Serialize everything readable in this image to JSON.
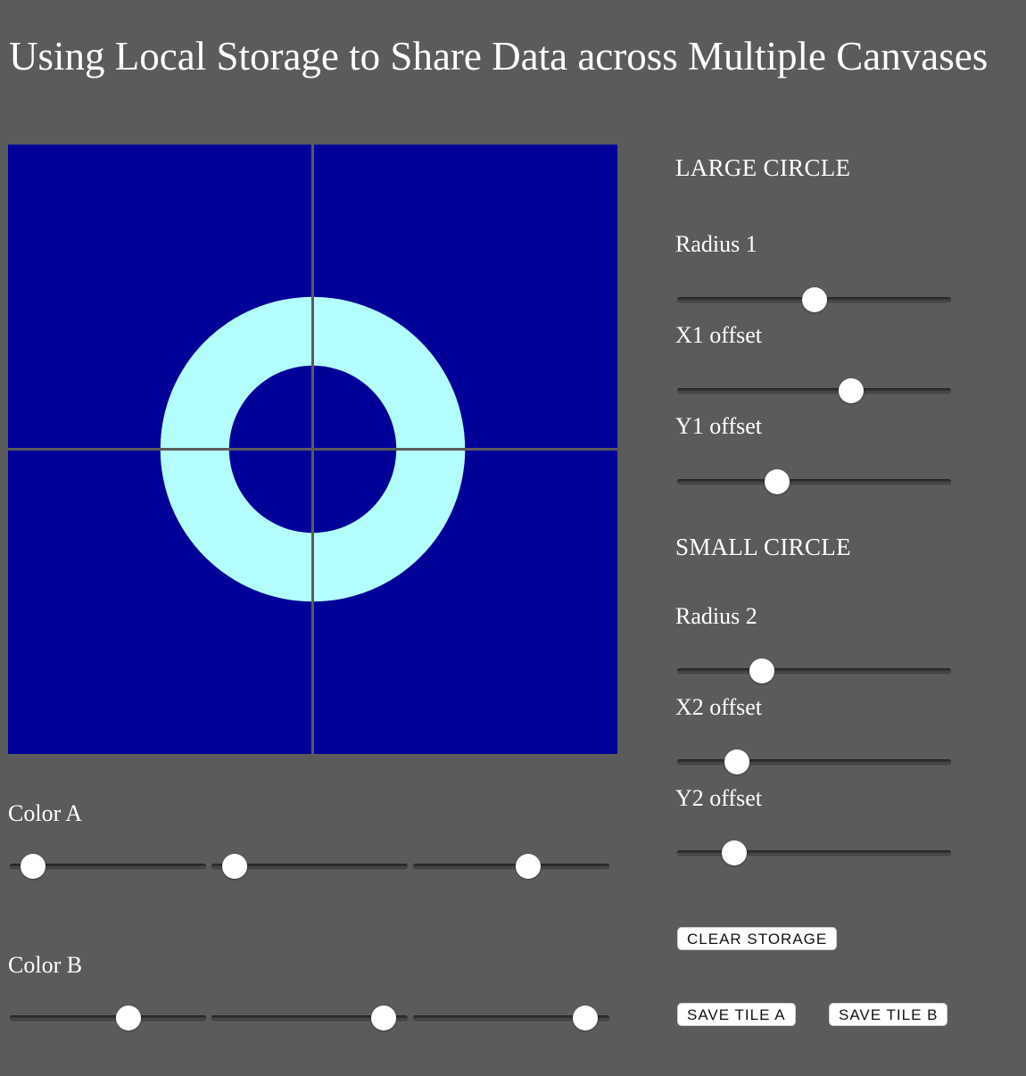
{
  "page": {
    "title": "Using Local Storage to Share Data across Multiple Canvases"
  },
  "canvas": {
    "background": "#000099",
    "ring_color": "#b3ffff",
    "divider_color": "#5b5b5b",
    "large_circle": {
      "radius": 0.5,
      "x_offset": 0.5,
      "y_offset": 0.5
    },
    "small_circle": {
      "radius": 0.28,
      "x_offset": 0.5,
      "y_offset": 0.5
    }
  },
  "color_a": {
    "label": "Color A",
    "sliders": [
      {
        "name": "red",
        "value": 0.06
      },
      {
        "name": "green",
        "value": 0.06
      },
      {
        "name": "blue",
        "value": 0.6
      }
    ]
  },
  "color_b": {
    "label": "Color B",
    "sliders": [
      {
        "name": "red",
        "value": 0.62
      },
      {
        "name": "green",
        "value": 0.93
      },
      {
        "name": "blue",
        "value": 0.93
      }
    ]
  },
  "large_circle": {
    "heading": "LARGE CIRCLE",
    "radius_label": "Radius 1",
    "radius_value": 0.5,
    "x_label": "X1 offset",
    "x_value": 0.65,
    "y_label": "Y1 offset",
    "y_value": 0.35
  },
  "small_circle": {
    "heading": "SMALL CIRCLE",
    "radius_label": "Radius 2",
    "radius_value": 0.29,
    "x_label": "X2 offset",
    "x_value": 0.19,
    "y_label": "Y2 offset",
    "y_value": 0.18
  },
  "buttons": {
    "clear_storage": "CLEAR STORAGE",
    "save_tile_a": "SAVE TILE A",
    "save_tile_b": "SAVE TILE B"
  }
}
